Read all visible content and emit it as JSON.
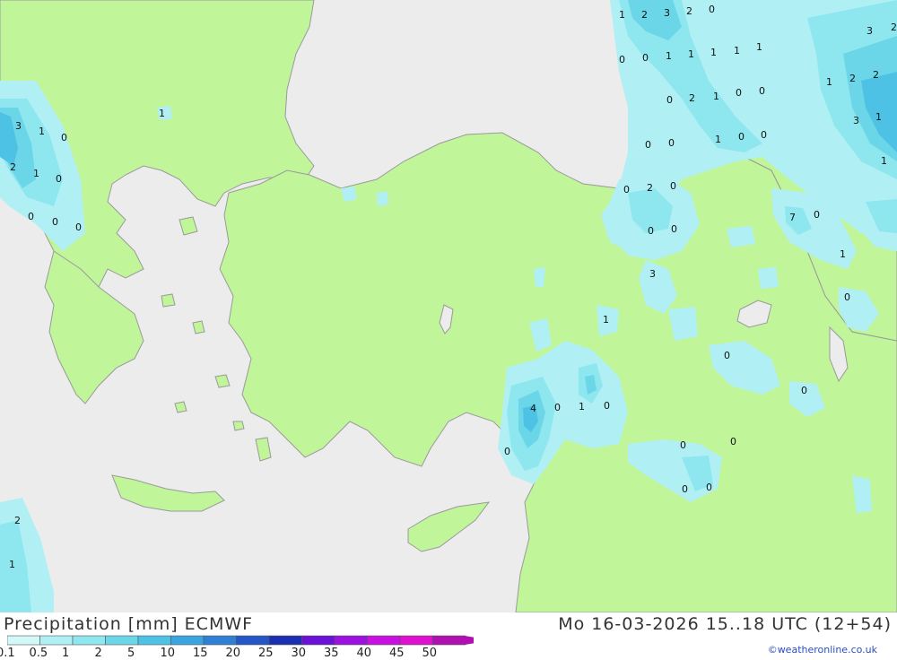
{
  "header": {
    "title": "Precipitation [mm] ECMWF",
    "datetime": "Mo 16-03-2026 15..18 UTC (12+54)",
    "credit": "©weatheronline.co.uk"
  },
  "legend": {
    "values": [
      "0.1",
      "0.5",
      "1",
      "2",
      "5",
      "10",
      "15",
      "20",
      "25",
      "30",
      "35",
      "40",
      "45",
      "50"
    ],
    "colors": [
      "#d2f8f8",
      "#b0f0f4",
      "#8ee6ee",
      "#6ad6e8",
      "#4ec2e4",
      "#3aa4de",
      "#2e80d6",
      "#2456c8",
      "#1a30b0",
      "#6a10d8",
      "#9c10e0",
      "#c810e0",
      "#e010d0",
      "#b010b0"
    ]
  },
  "colors": {
    "land": "#c0f59a",
    "sea": "#ececec",
    "border": "#9a9a9a"
  },
  "map_labels": [
    {
      "text": "1"
    },
    {
      "text": "2"
    },
    {
      "text": "3"
    },
    {
      "text": "2"
    },
    {
      "text": "0"
    },
    {
      "text": "0"
    },
    {
      "text": "0"
    },
    {
      "text": "1"
    },
    {
      "text": "1"
    },
    {
      "text": "1"
    },
    {
      "text": "1"
    },
    {
      "text": "1"
    },
    {
      "text": "0"
    },
    {
      "text": "2"
    },
    {
      "text": "1"
    },
    {
      "text": "0"
    },
    {
      "text": "0"
    },
    {
      "text": "0"
    },
    {
      "text": "0"
    },
    {
      "text": "1"
    },
    {
      "text": "0"
    },
    {
      "text": "0"
    },
    {
      "text": "0"
    },
    {
      "text": "2"
    },
    {
      "text": "0"
    },
    {
      "text": "0"
    },
    {
      "text": "0"
    },
    {
      "text": "3"
    },
    {
      "text": "1"
    },
    {
      "text": "7"
    },
    {
      "text": "0"
    },
    {
      "text": "1"
    },
    {
      "text": "0"
    },
    {
      "text": "0"
    },
    {
      "text": "0"
    },
    {
      "text": "4"
    },
    {
      "text": "0"
    },
    {
      "text": "1"
    },
    {
      "text": "0"
    },
    {
      "text": "0"
    },
    {
      "text": "0"
    },
    {
      "text": "0"
    },
    {
      "text": "0"
    },
    {
      "text": "0"
    },
    {
      "text": "3"
    },
    {
      "text": "1"
    },
    {
      "text": "0"
    },
    {
      "text": "2"
    },
    {
      "text": "1"
    },
    {
      "text": "0"
    },
    {
      "text": "0"
    },
    {
      "text": "0"
    },
    {
      "text": "0"
    },
    {
      "text": "1"
    },
    {
      "text": "3"
    },
    {
      "text": "2"
    },
    {
      "text": "1"
    },
    {
      "text": "2"
    },
    {
      "text": "2"
    },
    {
      "text": "3"
    },
    {
      "text": "1"
    },
    {
      "text": "1"
    },
    {
      "text": "2"
    },
    {
      "text": "1"
    }
  ]
}
